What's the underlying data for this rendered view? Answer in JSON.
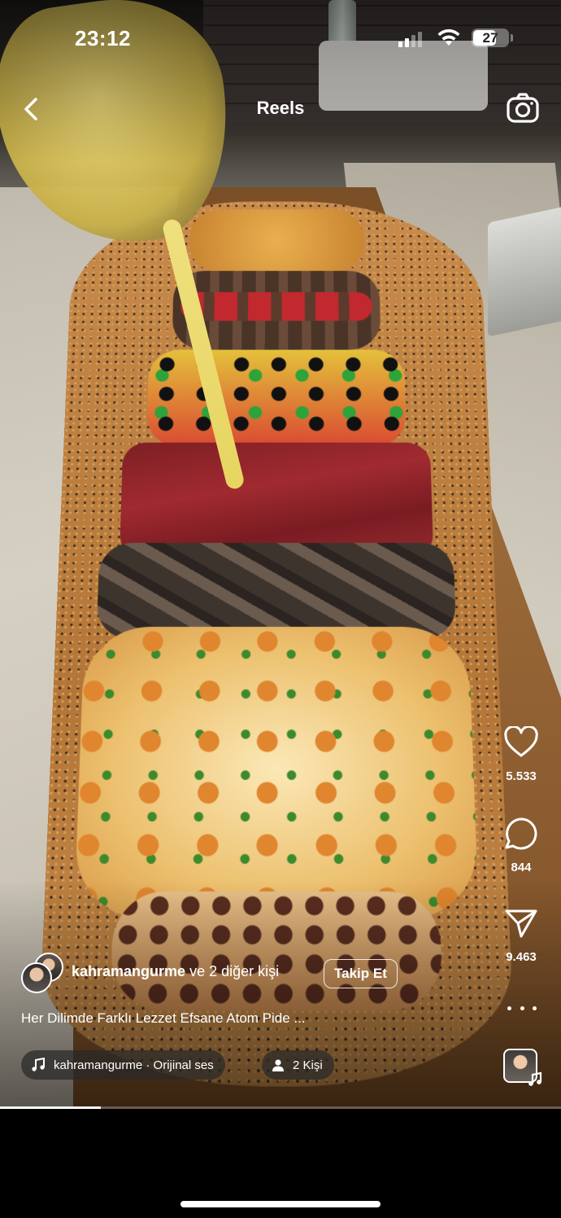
{
  "status_bar": {
    "time": "23:12",
    "battery": "27",
    "signal_bars_active": 2,
    "signal_bars_total": 4
  },
  "header": {
    "title": "Reels",
    "back_icon": "chevron-left-icon",
    "camera_icon": "camera-icon"
  },
  "actions": {
    "like_count": "5.533",
    "comment_count": "844",
    "share_count": "9.463",
    "like_icon": "heart-icon",
    "comment_icon": "speech-bubble-icon",
    "share_icon": "paper-plane-icon",
    "more_icon": "ellipsis-icon"
  },
  "post": {
    "author": "kahramangurme",
    "collaborators": "ve 2 diğer kişi",
    "follow_label": "Takip Et",
    "caption": "Her Dilimde Farklı Lezzet Efsane Atom Pide ...",
    "audio_label": "kahramangurme · Orijinal ses",
    "people_label": "2 Kişi"
  },
  "playback": {
    "progress": 0.18
  },
  "colors": {
    "text": "#ffffff",
    "chip_bg": "#282828",
    "background": "#000000"
  }
}
